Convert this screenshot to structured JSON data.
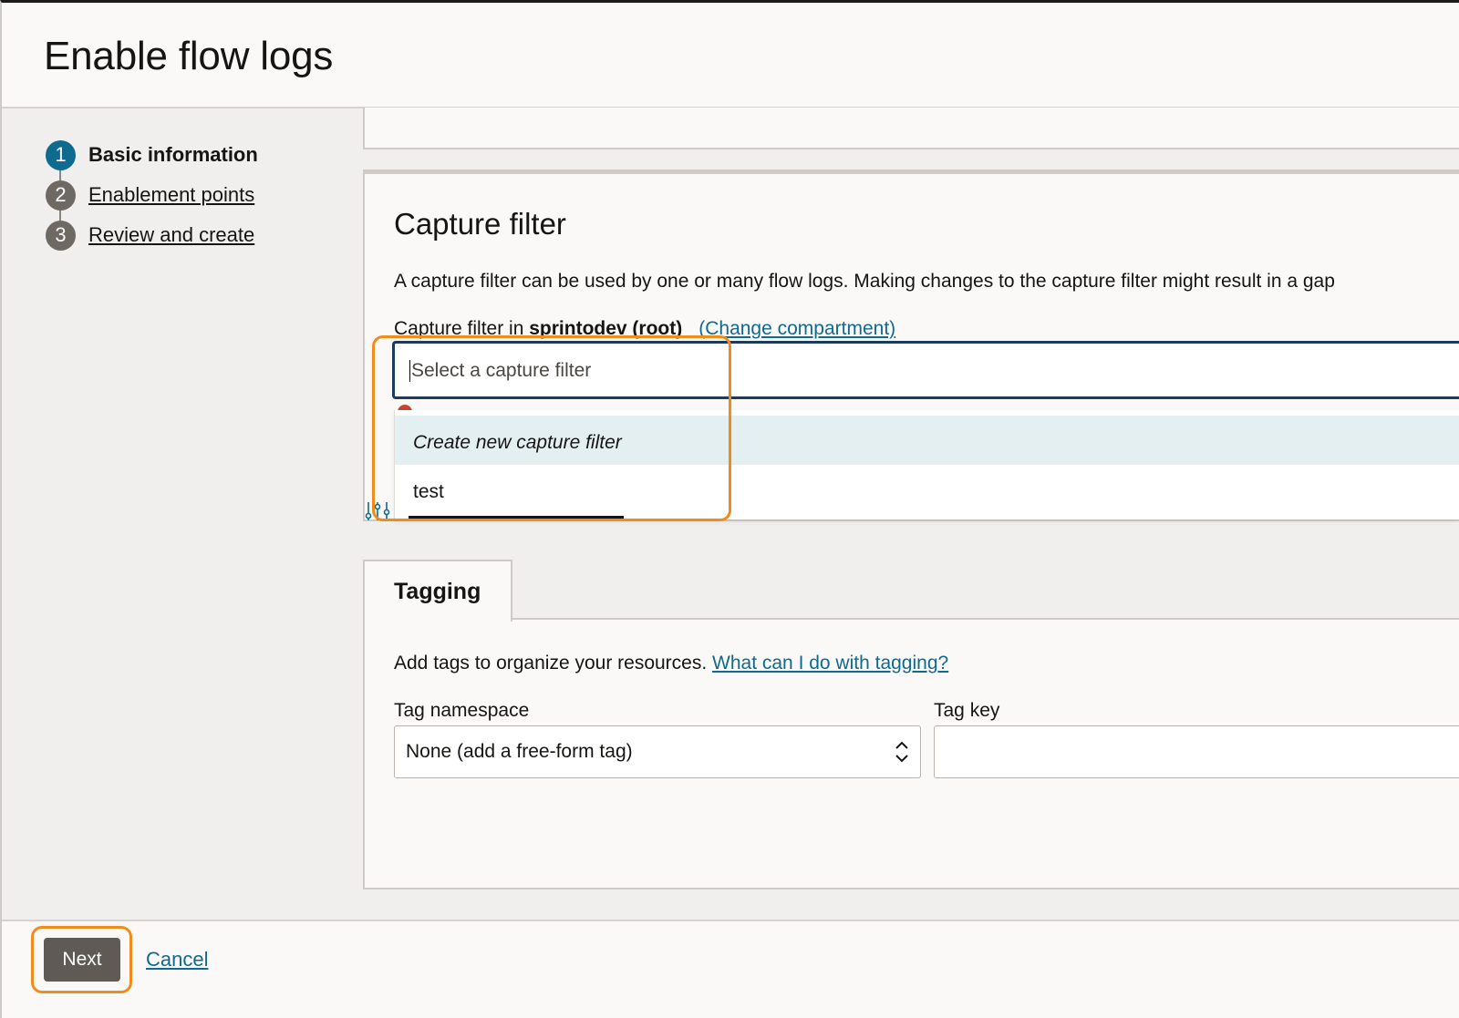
{
  "page": {
    "title": "Enable flow logs"
  },
  "steps": [
    {
      "number": "1",
      "label": "Basic information",
      "state": "active"
    },
    {
      "number": "2",
      "label": "Enablement points",
      "state": "link"
    },
    {
      "number": "3",
      "label": "Review and create",
      "state": "link"
    }
  ],
  "capture_filter": {
    "heading": "Capture filter",
    "description": "A capture filter can be used by one or many flow logs. Making changes to the capture filter might result in a gap",
    "label_prefix": "Capture filter in ",
    "compartment": "sprintodev (root)",
    "change_link": "(Change compartment)",
    "placeholder": "Select a capture filter",
    "options": [
      {
        "label": "Create new capture filter",
        "highlighted": true
      },
      {
        "label": "test",
        "highlighted": false
      }
    ]
  },
  "tagging": {
    "tab_label": "Tagging",
    "help_text": "Add tags to organize your resources. ",
    "help_link": "What can I do with tagging?",
    "namespace_label": "Tag namespace",
    "namespace_value": "None (add a free-form tag)",
    "key_label": "Tag key",
    "key_value": ""
  },
  "footer": {
    "next_label": "Next",
    "cancel_label": "Cancel"
  },
  "colors": {
    "accent": "#0f6a8f",
    "highlight": "#f08c1b",
    "primary_button": "#605a55",
    "error": "#c74634"
  }
}
